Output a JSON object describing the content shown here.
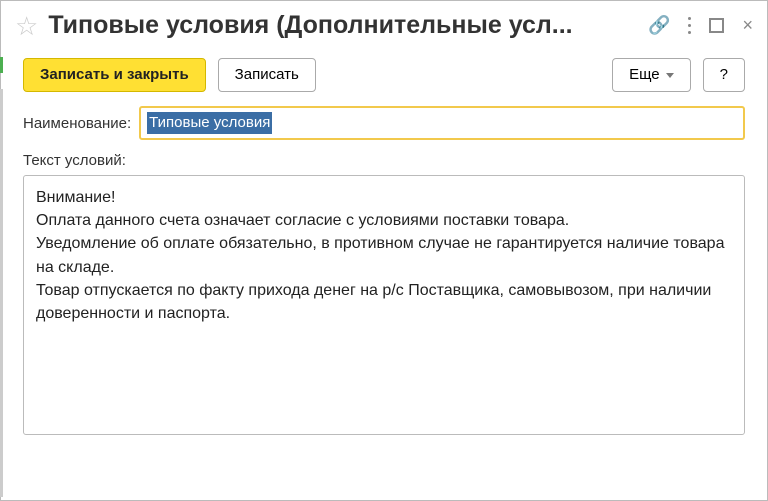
{
  "header": {
    "title": "Типовые условия (Дополнительные усл..."
  },
  "toolbar": {
    "save_close": "Записать и закрыть",
    "save": "Записать",
    "more": "Еще",
    "help": "?"
  },
  "form": {
    "name_label": "Наименование:",
    "name_value": "Типовые условия",
    "conditions_label": "Текст условий:",
    "conditions_text": "Внимание!\nОплата данного счета означает согласие с условиями поставки товара.\nУведомление об оплате обязательно, в противном случае не гарантируется наличие товара на складе.\nТовар отпускается по факту прихода денег на р/с Поставщика, самовывозом, при наличии доверенности и паспорта."
  }
}
